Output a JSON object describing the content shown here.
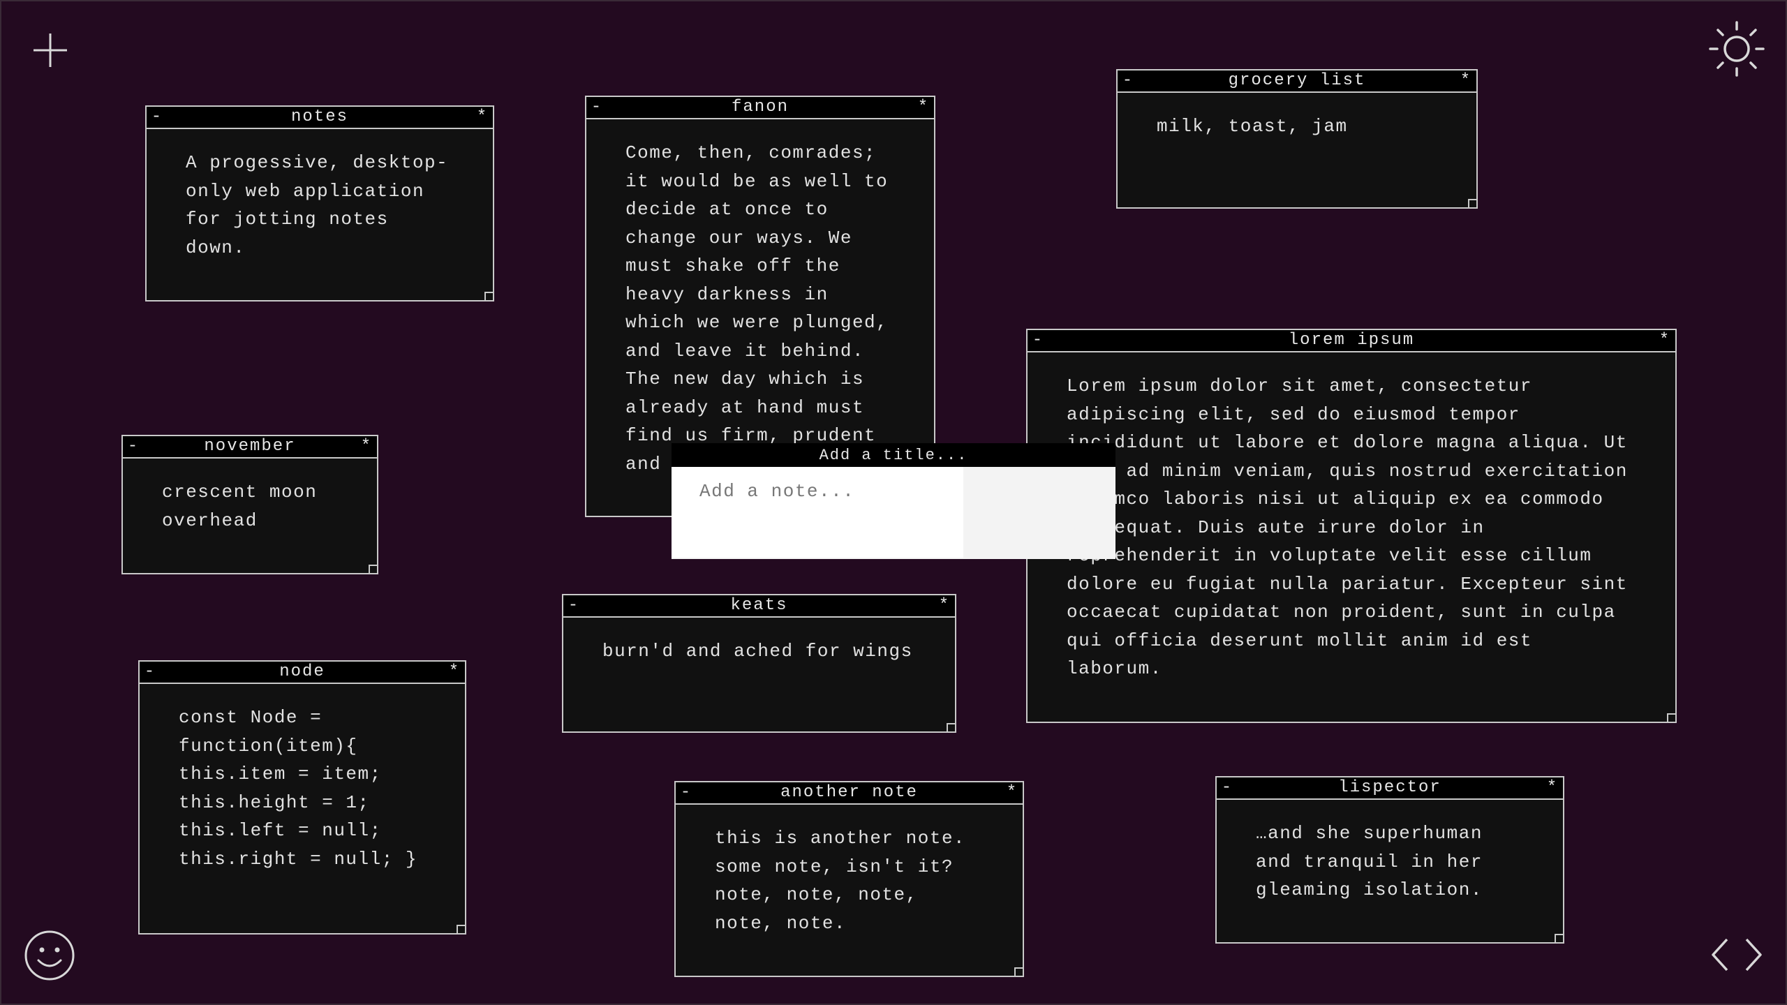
{
  "toolbar": {
    "add_icon": "plus-icon",
    "theme_icon": "sun-icon",
    "mood_icon": "smiley-icon",
    "nav_icon": "code-brackets-icon"
  },
  "colors": {
    "background": "#230a20",
    "note_body": "#111111",
    "note_border": "#c9c9c9",
    "titlebar": "#000000"
  },
  "creator": {
    "title_placeholder": "Add a title...",
    "note_placeholder": "Add a note..."
  },
  "notes": [
    {
      "title": "notes",
      "minimize": "-",
      "star": "*",
      "body": "A progessive, desktop-\nonly web application\nfor jotting notes\ndown."
    },
    {
      "title": "fanon",
      "minimize": "-",
      "star": "*",
      "body": "Come, then, comrades;\nit would be as well to\ndecide at once to\nchange our ways. We\nmust shake off the\nheavy darkness in\nwhich we were plunged,\nand leave it behind.\nThe new day which is\nalready at hand must\nfind us firm, prudent\nand"
    },
    {
      "title": "grocery list",
      "minimize": "-",
      "star": "*",
      "body": "milk, toast, jam"
    },
    {
      "title": "lorem ipsum",
      "minimize": "-",
      "star": "*",
      "body": "Lorem ipsum dolor sit amet, consectetur\nadipiscing elit, sed do eiusmod tempor\nincididunt ut labore et dolore magna aliqua. Ut\nenim ad minim veniam, quis nostrud exercitation\nullamco laboris nisi ut aliquip ex ea commodo\nconsequat. Duis aute irure dolor in\nreprehenderit in voluptate velit esse cillum\ndolore eu fugiat nulla pariatur. Excepteur sint\noccaecat cupidatat non proident, sunt in culpa\nqui officia deserunt mollit anim id est\nlaborum."
    },
    {
      "title": "november",
      "minimize": "-",
      "star": "*",
      "body": "crescent moon\noverhead"
    },
    {
      "title": "keats",
      "minimize": "-",
      "star": "*",
      "body": "burn'd and ached for wings"
    },
    {
      "title": "node",
      "minimize": "-",
      "star": "*",
      "body": "const Node =\nfunction(item){\nthis.item = item;\nthis.height = 1;\nthis.left = null;\nthis.right = null; }"
    },
    {
      "title": "another note",
      "minimize": "-",
      "star": "*",
      "body": "this is another note.\nsome note, isn't it?\nnote, note, note,\nnote, note."
    },
    {
      "title": "lispector",
      "minimize": "-",
      "star": "*",
      "body": "…and she superhuman\nand tranquil in her\ngleaming isolation."
    }
  ]
}
